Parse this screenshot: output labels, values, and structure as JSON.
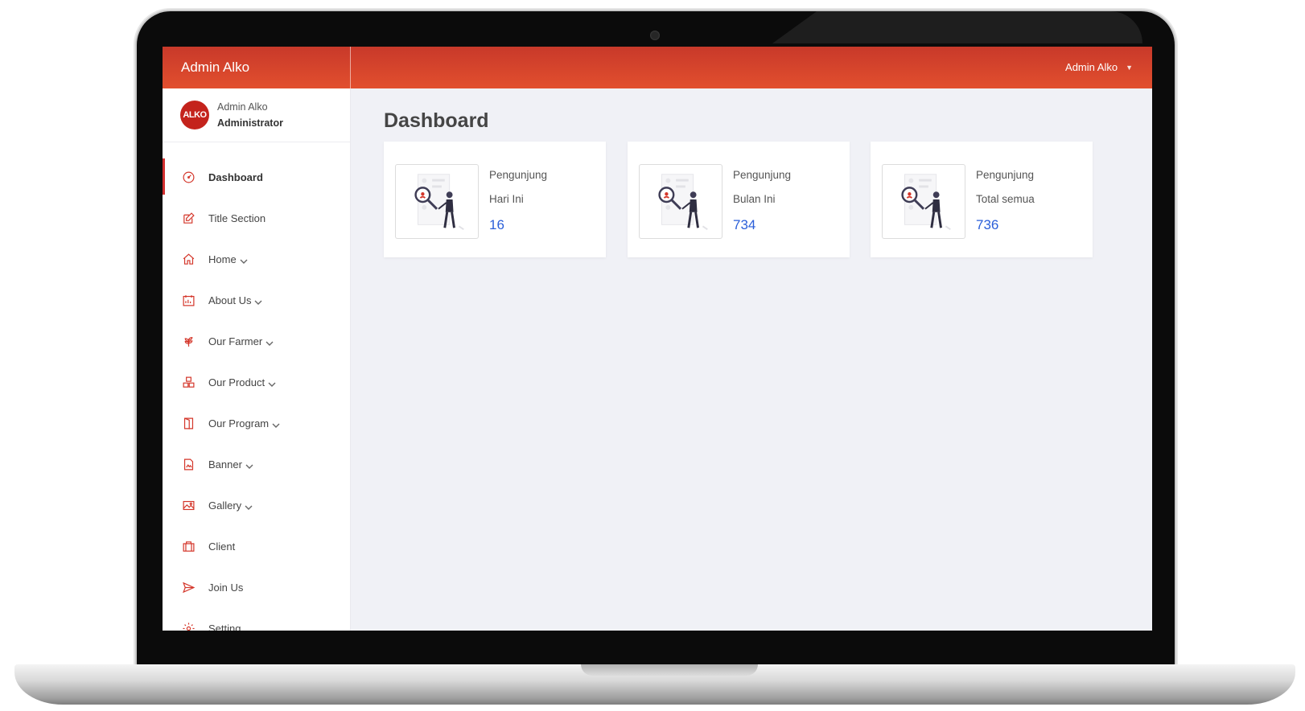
{
  "app": {
    "brand": "Admin Alko",
    "user_menu_label": "Admin Alko",
    "accent_color": "#d4362a",
    "topbar_gradient": [
      "#c8392a",
      "#e24f2e"
    ],
    "value_color": "#2b5fd9"
  },
  "profile": {
    "avatar_text": "ALKO",
    "name": "Admin Alko",
    "role": "Administrator"
  },
  "sidebar": {
    "items": [
      {
        "label": "Dashboard",
        "icon": "gauge-icon",
        "active": true,
        "has_submenu": false
      },
      {
        "label": "Title Section",
        "icon": "edit-icon",
        "active": false,
        "has_submenu": false
      },
      {
        "label": "Home",
        "icon": "home-icon",
        "active": false,
        "has_submenu": true
      },
      {
        "label": "About Us",
        "icon": "calendar-chart-icon",
        "active": false,
        "has_submenu": true
      },
      {
        "label": "Our Farmer",
        "icon": "plant-icon",
        "active": false,
        "has_submenu": true
      },
      {
        "label": "Our Product",
        "icon": "boxes-icon",
        "active": false,
        "has_submenu": true
      },
      {
        "label": "Our Program",
        "icon": "door-icon",
        "active": false,
        "has_submenu": true
      },
      {
        "label": "Banner",
        "icon": "file-image-icon",
        "active": false,
        "has_submenu": true
      },
      {
        "label": "Gallery",
        "icon": "image-icon",
        "active": false,
        "has_submenu": true
      },
      {
        "label": "Client",
        "icon": "briefcase-icon",
        "active": false,
        "has_submenu": false
      },
      {
        "label": "Join Us",
        "icon": "send-icon",
        "active": false,
        "has_submenu": false
      },
      {
        "label": "Setting",
        "icon": "gear-icon",
        "active": false,
        "has_submenu": false
      }
    ]
  },
  "main": {
    "title": "Dashboard",
    "cards": [
      {
        "line1": "Pengunjung",
        "line2": "Hari Ini",
        "value": "16",
        "illustration": "search-person-illustration"
      },
      {
        "line1": "Pengunjung",
        "line2": "Bulan Ini",
        "value": "734",
        "illustration": "search-person-illustration"
      },
      {
        "line1": "Pengunjung",
        "line2": "Total semua",
        "value": "736",
        "illustration": "search-person-illustration"
      }
    ]
  }
}
